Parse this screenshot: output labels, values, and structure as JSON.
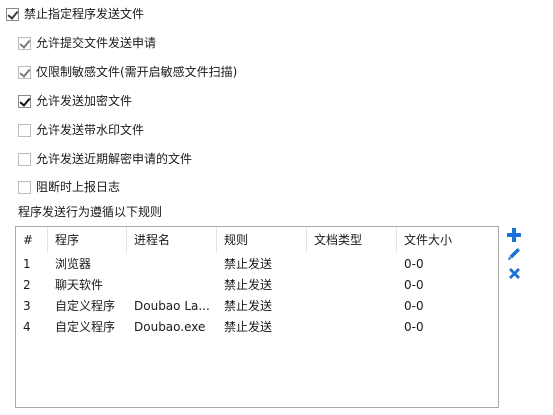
{
  "options": {
    "forbid_send": {
      "label": "禁止指定程序发送文件",
      "checked": true
    },
    "allow_apply": {
      "label": "允许提交文件发送申请",
      "checked": true
    },
    "sensitive_only": {
      "label": "仅限制敏感文件(需开启敏感文件扫描)",
      "checked": true
    },
    "allow_encrypted": {
      "label": "允许发送加密文件",
      "checked": true
    },
    "allow_watermark": {
      "label": "允许发送带水印文件",
      "checked": false
    },
    "allow_recent_decrypt": {
      "label": "允许发送近期解密申请的文件",
      "checked": false
    },
    "report_log": {
      "label": "阻断时上报日志",
      "checked": false
    }
  },
  "rules_section_label": "程序发送行为遵循以下规则",
  "table": {
    "columns": [
      "#",
      "程序",
      "进程名",
      "规则",
      "文档类型",
      "文件大小"
    ],
    "rows": [
      {
        "num": "1",
        "program": "浏览器",
        "process": "",
        "rule": "禁止发送",
        "doc_type": "",
        "size": "0-0"
      },
      {
        "num": "2",
        "program": "聊天软件",
        "process": "",
        "rule": "禁止发送",
        "doc_type": "",
        "size": "0-0"
      },
      {
        "num": "3",
        "program": "自定义程序",
        "process": "Doubao La...",
        "rule": "禁止发送",
        "doc_type": "",
        "size": "0-0"
      },
      {
        "num": "4",
        "program": "自定义程序",
        "process": "Doubao.exe",
        "rule": "禁止发送",
        "doc_type": "",
        "size": "0-0"
      }
    ]
  },
  "toolbar": {
    "add_icon": "plus-icon",
    "edit_icon": "pencil-icon",
    "delete_icon": "x-icon",
    "accent_color": "#1a73d6"
  }
}
